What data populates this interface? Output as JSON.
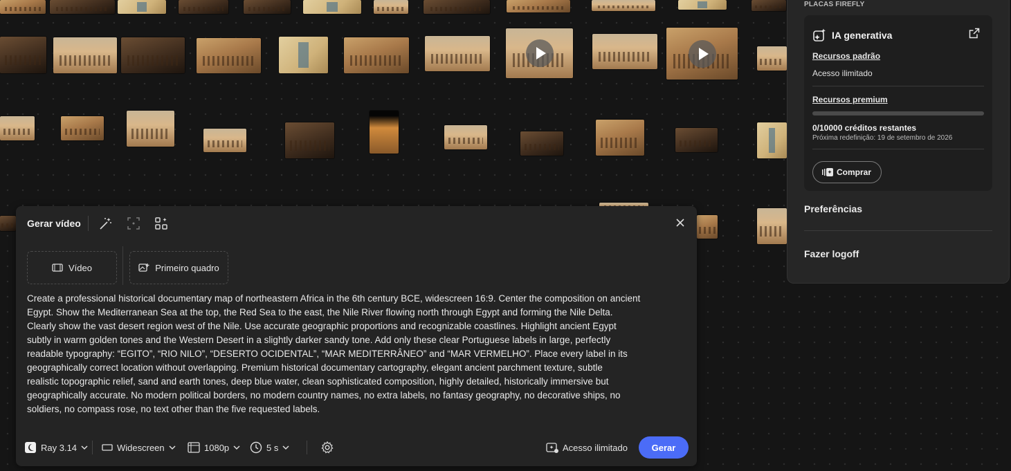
{
  "account_menu": {
    "section_title": "PLACAS FIREFLY",
    "ai_title": "IA generativa",
    "standard_label": "Recursos padrão",
    "standard_value": "Acesso ilimitado",
    "premium_label": "Recursos premium",
    "premium_progress": 0,
    "credits": "0/10000 créditos restantes",
    "reset": "Próxima redefinição: 19 de setembro de 2026",
    "buy": "Comprar",
    "preferences": "Preferências",
    "logout": "Fazer logoff"
  },
  "generate_panel": {
    "title": "Gerar vídeo",
    "tab_video": "Vídeo",
    "tab_first_frame": "Primeiro quadro",
    "prompt": "Create a professional historical documentary map of northeastern Africa in the 6th century BCE, widescreen 16:9. Center the composition on ancient\nEgypt. Show the Mediterranean Sea at the top, the Red Sea to the east, the Nile River flowing north through Egypt and forming the Nile Delta.\nClearly show the vast desert region west of the Nile. Use accurate geographic proportions and recognizable coastlines. Highlight ancient Egypt\nsubtly in warm golden tones and the Western Desert in a slightly darker sandy tone. Add only these clear Portuguese labels in large, perfectly\nreadable typography: “EGITO”, “RIO NILO”, “DESERTO OCIDENTAL”, “MAR MEDITERRÂNEO” and “MAR VERMELHO”. Place every label in its\ngeographically correct location without overlapping. Premium historical documentary cartography, elegant ancient parchment texture, subtle\nrealistic topographic relief, sand and earth tones, deep blue water, clean sophisticated composition, highly detailed, historically immersive but\ngeographically accurate. No modern political borders, no modern country names, no extra labels, no fantasy geography, no decorative ships, no\nsoldiers, no compass rose, no text other than the five requested labels.",
    "model": "Ray 3.14",
    "aspect": "Widescreen",
    "resolution": "1080p",
    "duration": "5 s",
    "access": "Acesso ilimitado",
    "generate": "Gerar"
  },
  "colors": {
    "accent": "#4b6cf7",
    "panel": "#242424",
    "background": "#151515"
  }
}
